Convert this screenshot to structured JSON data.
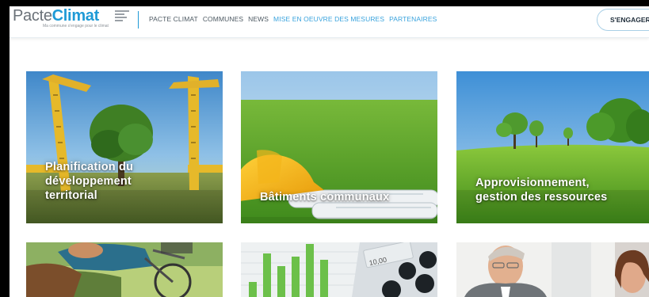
{
  "header": {
    "logo": {
      "word_pacte": "Pacte",
      "word_climat": "Climat",
      "tagline": "Ma commune s'engage pour le climat"
    },
    "nav": [
      {
        "label": "PACTE CLIMAT",
        "color": "#4e5a63"
      },
      {
        "label": "COMMUNES",
        "color": "#4e5a63"
      },
      {
        "label": "NEWS",
        "color": "#4e5a63"
      },
      {
        "label": "MISE EN OEUVRE DES MESURES",
        "color": "#3aa3dd"
      },
      {
        "label": "PARTENAIRES",
        "color": "#3aa3dd"
      }
    ],
    "cta_label": "S'ENGAGER"
  },
  "tiles": [
    {
      "lines": [
        "Planification du",
        "développement",
        "territorial"
      ],
      "icon": "measuring-rule-tree-photo"
    },
    {
      "lines": [
        "Bâtiments communaux"
      ],
      "icon": "hard-hat-blueprint-photo"
    },
    {
      "lines": [
        "Approvisionnement,",
        "gestion des ressources"
      ],
      "icon": "green-field-trees-photo"
    },
    {
      "lines": [],
      "icon": "cyclist-photo"
    },
    {
      "lines": [],
      "icon": "chart-calculator-photo"
    },
    {
      "lines": [],
      "icon": "business-people-photo"
    }
  ],
  "tile_extras": {
    "calculator_readout": "10,00"
  },
  "colors": {
    "brand_blue": "#1e9ad6",
    "nav_dark": "#4e5a63",
    "nav_blue": "#3aa3dd"
  }
}
